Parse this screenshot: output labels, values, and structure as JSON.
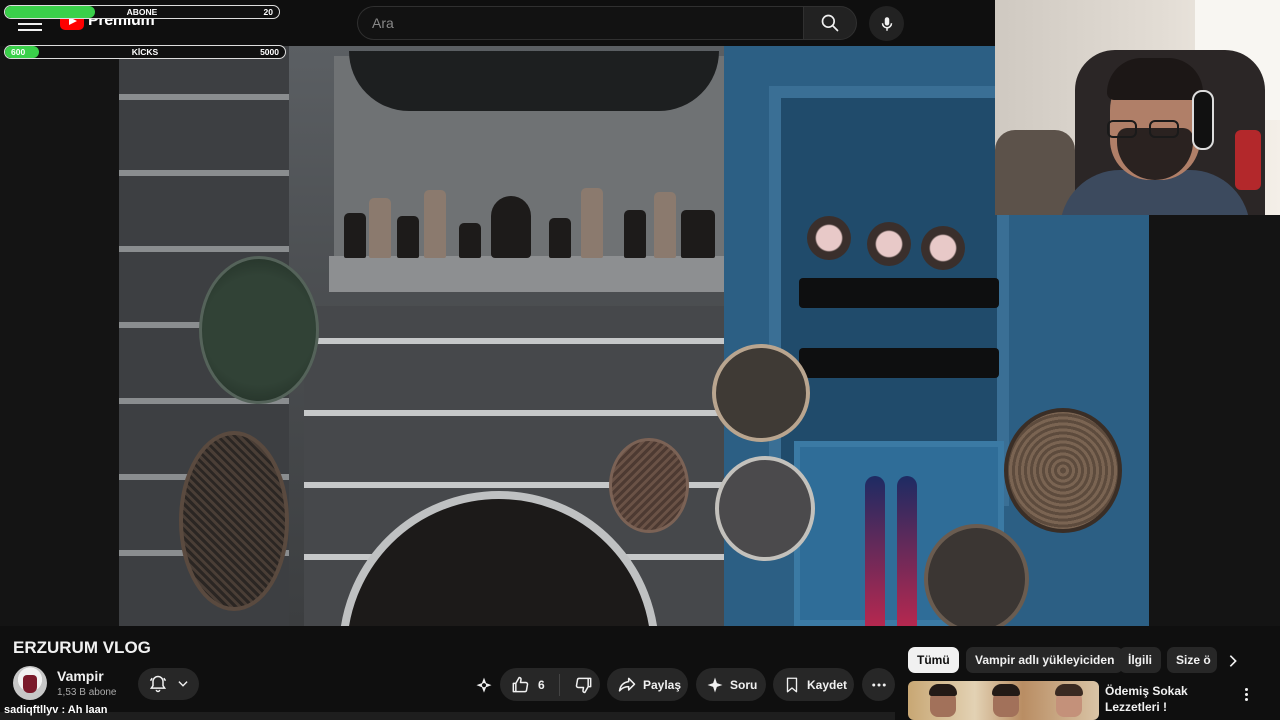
{
  "header": {
    "logo_text": "Premium",
    "search_placeholder": "Ara"
  },
  "overlay": {
    "abone_goal": {
      "label": "ABONE",
      "right_value": "20",
      "progress_fraction": 0.33
    },
    "kicks_goal": {
      "label": "KİCKS",
      "left_value": "600",
      "right_value": "5000",
      "progress_fraction": 0.12
    }
  },
  "video": {
    "title": "ERZURUM VLOG"
  },
  "channel": {
    "name": "Vampir",
    "subscribers": "1,53 B abone"
  },
  "actions": {
    "like_count": "6",
    "share_label": "Paylaş",
    "ask_label": "Soru",
    "save_label": "Kaydet"
  },
  "chat_overlay": {
    "line": "sadiqftllyv : Ah laan"
  },
  "chips": {
    "all": "Tümü",
    "uploader": "Vampir adlı yükleyiciden",
    "related": "İlgili",
    "for_you": "Size ö"
  },
  "suggestion": {
    "title": "Ödemiş Sokak Lezzetleri !"
  },
  "colors": {
    "background": "#0f0f0f",
    "pill": "#272727",
    "accent_red": "#ff0000",
    "goal_green": "#3ad04a"
  },
  "icons": [
    "menu-icon",
    "youtube-logo-icon",
    "search-icon",
    "mic-icon",
    "bell-icon",
    "chevron-down-icon",
    "like-icon",
    "dislike-icon",
    "share-icon",
    "sparkle-icon",
    "bookmark-icon",
    "more-icon",
    "chevron-right-icon"
  ]
}
